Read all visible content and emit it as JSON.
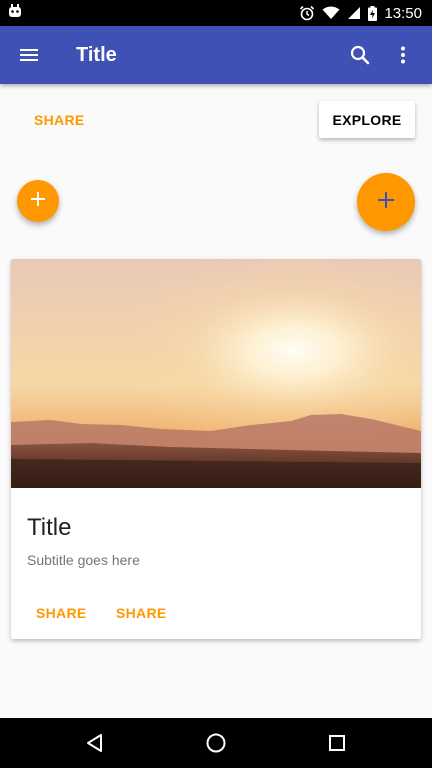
{
  "status_bar": {
    "time": "13:50",
    "icons": [
      "android-debug-icon",
      "alarm-icon",
      "wifi-icon",
      "signal-icon",
      "battery-charging-icon"
    ]
  },
  "app_bar": {
    "title": "Title",
    "icons": [
      "menu-icon",
      "search-icon",
      "more-vert-icon"
    ],
    "color": "#3f51b5"
  },
  "buttons": {
    "share_label": "SHARE",
    "explore_label": "EXPLORE"
  },
  "fabs": {
    "icon": "add-icon",
    "color": "#ff9800"
  },
  "card": {
    "image_description": "desert-sunset-photo",
    "title": "Title",
    "subtitle": "Subtitle goes here",
    "actions": [
      "SHARE",
      "SHARE"
    ]
  },
  "nav_bar": {
    "icons": [
      "back-icon",
      "home-icon",
      "recents-icon"
    ]
  },
  "colors": {
    "accent": "#ff9800",
    "primary": "#3f51b5",
    "background": "#fafafa"
  }
}
